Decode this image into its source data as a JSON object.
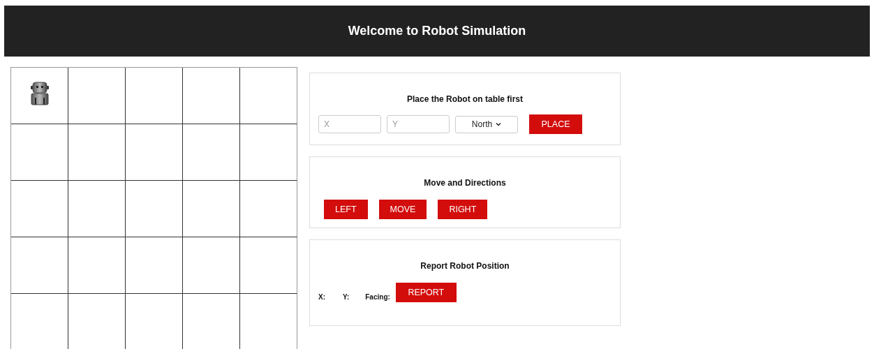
{
  "header": {
    "title": "Welcome to Robot Simulation"
  },
  "grid": {
    "rows": [
      {
        "cells": [
          {
            "robot": true
          },
          {
            "robot": false
          },
          {
            "robot": false
          },
          {
            "robot": false
          },
          {
            "robot": false
          }
        ]
      },
      {
        "cells": [
          {
            "robot": false
          },
          {
            "robot": false
          },
          {
            "robot": false
          },
          {
            "robot": false
          },
          {
            "robot": false
          }
        ]
      },
      {
        "cells": [
          {
            "robot": false
          },
          {
            "robot": false
          },
          {
            "robot": false
          },
          {
            "robot": false
          },
          {
            "robot": false
          }
        ]
      },
      {
        "cells": [
          {
            "robot": false
          },
          {
            "robot": false
          },
          {
            "robot": false
          },
          {
            "robot": false
          },
          {
            "robot": false
          }
        ]
      },
      {
        "cells": [
          {
            "robot": false
          },
          {
            "robot": false
          },
          {
            "robot": false
          },
          {
            "robot": false
          },
          {
            "robot": false
          }
        ]
      }
    ]
  },
  "place_panel": {
    "title": "Place the Robot on table first",
    "x_field": {
      "placeholder": "X"
    },
    "y_field": {
      "placeholder": "Y"
    },
    "direction": {
      "value": "North"
    },
    "button": "PLACE"
  },
  "move_panel": {
    "title": "Move and Directions",
    "buttons": [
      "LEFT",
      "MOVE",
      "RIGHT"
    ]
  },
  "report_panel": {
    "title": "Report Robot Position",
    "x_label": "X:",
    "y_label": "Y:",
    "facing_label": "Facing:",
    "button": "REPORT"
  }
}
